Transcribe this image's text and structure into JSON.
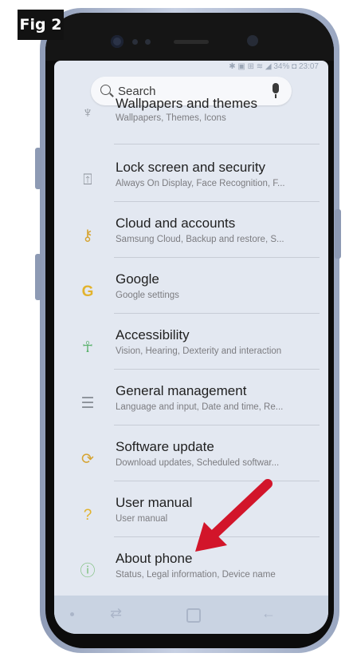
{
  "figure": {
    "label": "Fig 2"
  },
  "status_bar": {
    "text": "34% ◘ 23:07"
  },
  "search": {
    "placeholder": "Search"
  },
  "settings": [
    {
      "id": "wallpapers",
      "title": "Wallpapers and themes",
      "subtitle": "Wallpapers, Themes, Icons",
      "icon": "brush-icon",
      "color": "#8a9098"
    },
    {
      "id": "lock-screen",
      "title": "Lock screen and security",
      "subtitle": "Always On Display, Face Recognition, F...",
      "icon": "padlock-icon",
      "color": "#8a9098"
    },
    {
      "id": "cloud-accounts",
      "title": "Cloud and accounts",
      "subtitle": "Samsung Cloud, Backup and restore, S...",
      "icon": "key-icon",
      "color": "#d6a433"
    },
    {
      "id": "google",
      "title": "Google",
      "subtitle": "Google settings",
      "icon": "google-g-icon",
      "color": "#e2b32e"
    },
    {
      "id": "accessibility",
      "title": "Accessibility",
      "subtitle": "Vision, Hearing, Dexterity and interaction",
      "icon": "accessibility-person-icon",
      "color": "#5db36f"
    },
    {
      "id": "general-management",
      "title": "General management",
      "subtitle": "Language and input, Date and time, Re...",
      "icon": "sliders-icon",
      "color": "#8a9098"
    },
    {
      "id": "software-update",
      "title": "Software update",
      "subtitle": "Download updates, Scheduled softwar...",
      "icon": "update-icon",
      "color": "#d6a433"
    },
    {
      "id": "user-manual",
      "title": "User manual",
      "subtitle": "User manual",
      "icon": "question-book-icon",
      "color": "#e2b32e"
    },
    {
      "id": "about-phone",
      "title": "About phone",
      "subtitle": "Status, Legal information, Device name",
      "icon": "info-circle-icon",
      "color": "#7bbf7a"
    }
  ],
  "annotation": {
    "arrow_color": "#d2152a"
  }
}
